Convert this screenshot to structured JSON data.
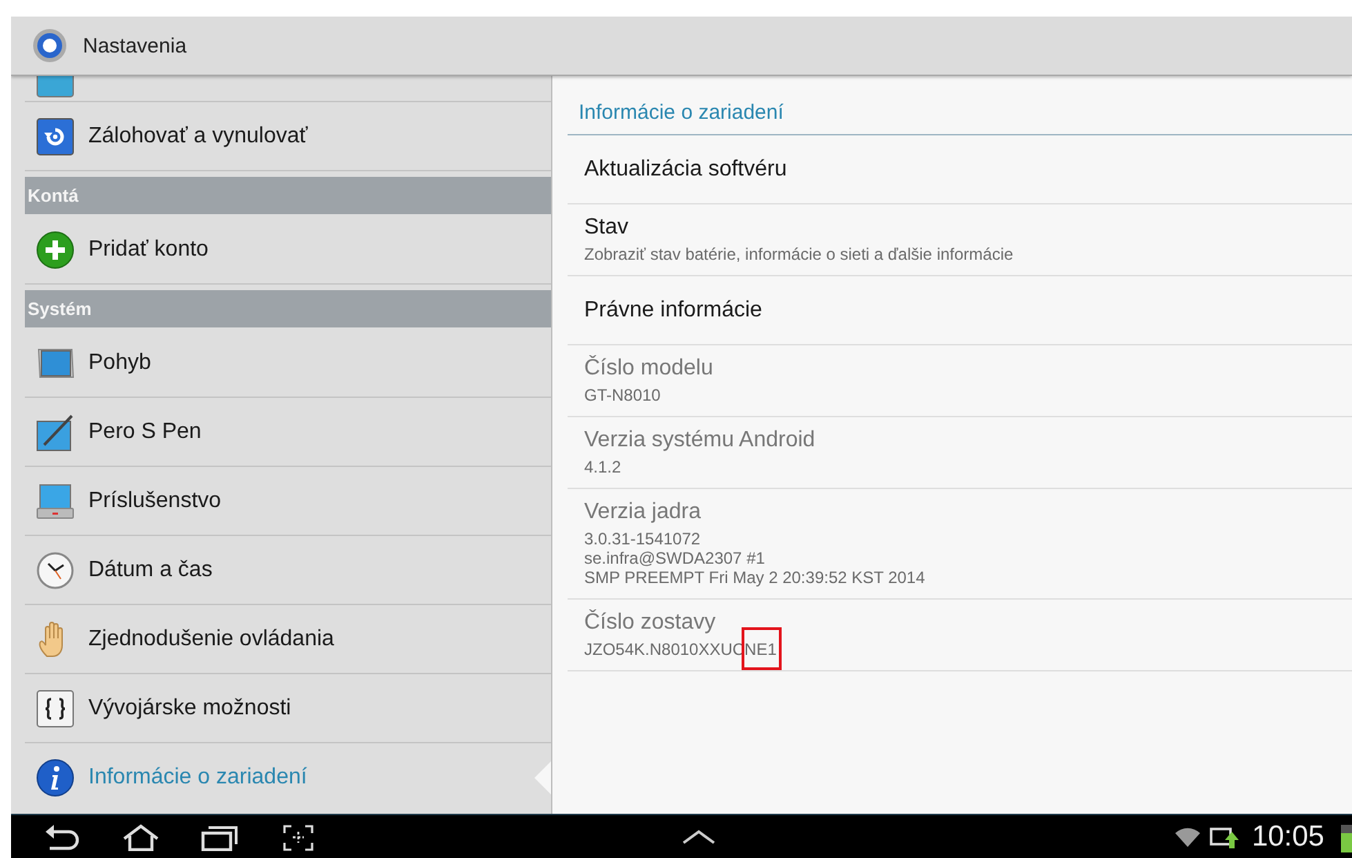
{
  "action_bar": {
    "title": "Nastavenia"
  },
  "sidebar": {
    "items": [
      {
        "kind": "partial"
      },
      {
        "kind": "item",
        "label": "Zálohovať a vynulovať",
        "selected": false
      },
      {
        "kind": "header",
        "label": "Kontá"
      },
      {
        "kind": "item",
        "label": "Pridať konto",
        "selected": false
      },
      {
        "kind": "header",
        "label": "Systém"
      },
      {
        "kind": "item",
        "label": "Pohyb",
        "selected": false
      },
      {
        "kind": "item",
        "label": "Pero S Pen",
        "selected": false
      },
      {
        "kind": "item",
        "label": "Príslušenstvo",
        "selected": false
      },
      {
        "kind": "item",
        "label": "Dátum a čas",
        "selected": false
      },
      {
        "kind": "item",
        "label": "Zjednodušenie ovládania",
        "selected": false
      },
      {
        "kind": "item",
        "label": "Vývojárske možnosti",
        "selected": false
      },
      {
        "kind": "item",
        "label": "Informácie o zariadení",
        "selected": true
      }
    ]
  },
  "detail": {
    "title": "Informácie o zariadení",
    "items": [
      {
        "title": "Aktualizácia softvéru",
        "disabled": false
      },
      {
        "title": "Stav",
        "summary": [
          "Zobraziť stav batérie, informácie o sieti a ďalšie informácie"
        ],
        "disabled": false
      },
      {
        "title": "Právne informácie",
        "disabled": false
      },
      {
        "title": "Číslo modelu",
        "summary": [
          "GT-N8010"
        ],
        "disabled": true
      },
      {
        "title": "Verzia systému Android",
        "summary": [
          "4.1.2"
        ],
        "disabled": true
      },
      {
        "title": "Verzia jadra",
        "summary": [
          "3.0.31-1541072",
          "se.infra@SWDA2307 #1",
          "SMP PREEMPT Fri May 2 20:39:52 KST 2014"
        ],
        "disabled": true
      },
      {
        "title": "Číslo zostavy",
        "summary": [
          "JZO54K.N8010XXUCNE1"
        ],
        "disabled": true,
        "highlighted": true
      }
    ]
  },
  "nav_bar": {
    "time": "10:05"
  }
}
